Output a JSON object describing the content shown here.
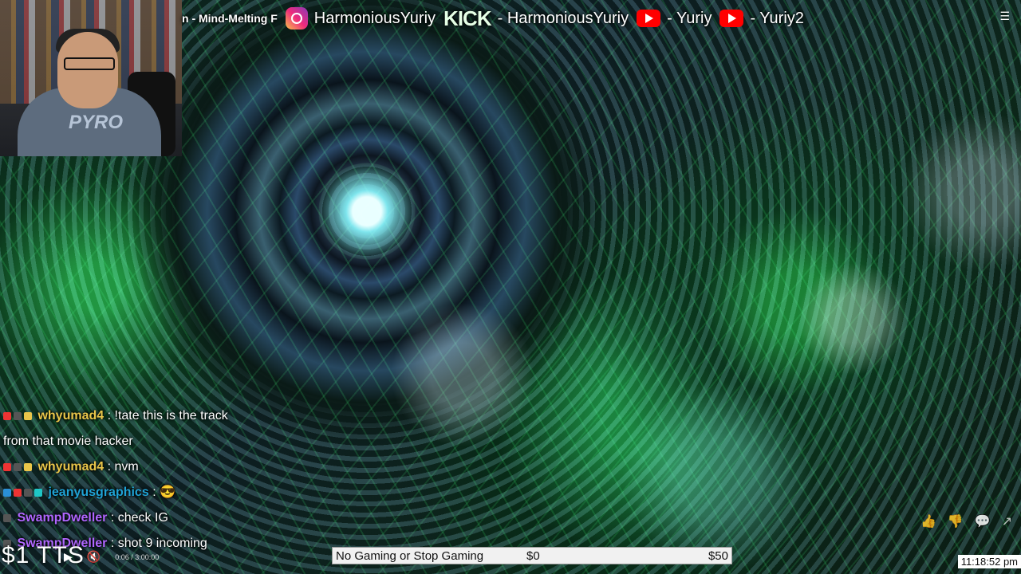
{
  "stream": {
    "title": "n - Mind-Melting F"
  },
  "socials": [
    {
      "icon": "instagram-icon",
      "handle": "HarmoniousYuriy"
    },
    {
      "icon": "kick-icon",
      "label": "KICK",
      "handle": "- HarmoniousYuriy"
    },
    {
      "icon": "youtube-icon",
      "handle": "- Yuriy"
    },
    {
      "icon": "youtube-icon",
      "handle": "- Yuriy2"
    }
  ],
  "webcam": {
    "shirt_text": "PYRO"
  },
  "chat": [
    {
      "user": "whyumad4",
      "sep": ":",
      "text": "!tate this is the track from that movie hacker",
      "color": "#e9c64a"
    },
    {
      "user": "whyumad4",
      "sep": ":",
      "text": "nvm",
      "color": "#e9c64a"
    },
    {
      "user": "jeanyusgraphics",
      "sep": ":",
      "text": "",
      "color": "#1fa3d6"
    },
    {
      "user": "SwampDweller",
      "sep": ":",
      "text": "check IG",
      "color": "#b066ff"
    },
    {
      "user": "SwampDweller",
      "sep": ":",
      "text": "shot 9 incoming",
      "color": "#b066ff"
    }
  ],
  "bottom": {
    "tts_label": "$1 TTS",
    "time": "0:06 / 3:00:00"
  },
  "goal": {
    "title": "No Gaming or Stop Gaming",
    "current": "$0",
    "target": "$50",
    "progress": 0
  },
  "clock": "11:18:52 pm"
}
